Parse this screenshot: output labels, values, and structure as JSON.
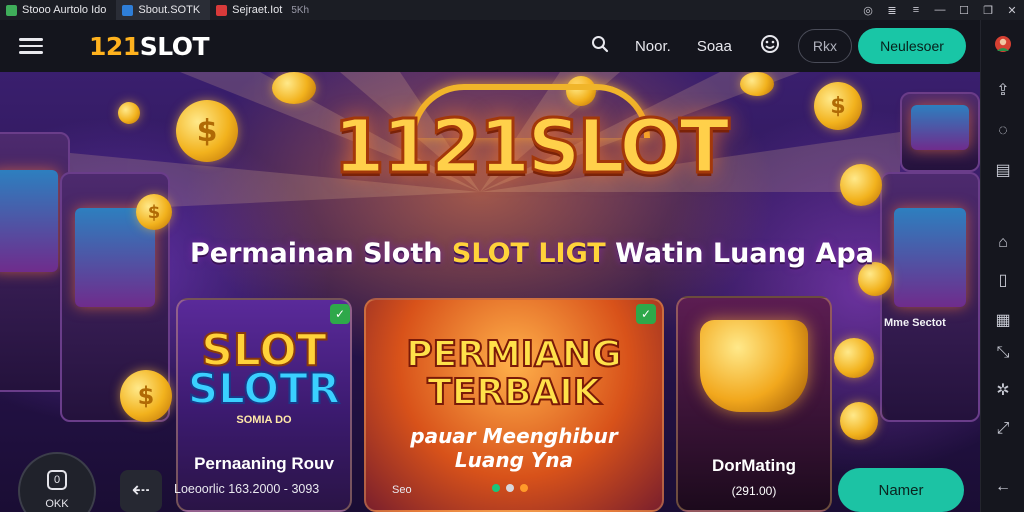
{
  "browser": {
    "tabs": [
      {
        "label": "Stooo Aurtolo Ido",
        "icon": "green-square-icon",
        "color": "#3fae5a"
      },
      {
        "label": "Sbout.SOTK",
        "icon": "blue-square-icon",
        "color": "#2e7ed8"
      },
      {
        "label": "Sejraet.Iot",
        "close": "5Kh",
        "icon": "red-square-icon",
        "color": "#d83a3a"
      }
    ],
    "window_controls": [
      "circle-icon",
      "list-icon",
      "menu-icon",
      "minimize-icon",
      "maximize-icon",
      "restore-icon",
      "close-icon"
    ]
  },
  "header": {
    "logo_num": "121",
    "logo_word": "SLOT",
    "link_1": "Noor.",
    "link_2": "Soaa",
    "outline_button": "Rkx",
    "primary_button": "Neulesoer"
  },
  "hero": {
    "title": "1121SLOT",
    "subtitle_a": "Permainan Sloth ",
    "subtitle_hl": "SLOT LIGT",
    "subtitle_b": " Watin Luang Apa"
  },
  "cards": [
    {
      "art_line1": "SLOT",
      "art_line2": "SLOTR",
      "art_small": "SOMIA DO",
      "caption": "Pernaaning Rouv"
    },
    {
      "art_line1": "PERMIANG",
      "art_line2": "TERBAIK",
      "art_line3": "pauar Meenghibur",
      "art_line4": "Luang Yna"
    },
    {
      "caption": "DorMating",
      "value": "(291.00)"
    }
  ],
  "side_note": "Mme Sectot",
  "bottom": {
    "ctrl_icon": "0",
    "ctrl_label": "OKK",
    "footnote": "Loeoorlic 163.2000 - 3093",
    "footnote2": "Seo",
    "button": "Namer"
  },
  "colors": {
    "accent": "#19c6a6",
    "logo_gold": "#ffb21e",
    "title_gold": "#ffd04a"
  }
}
